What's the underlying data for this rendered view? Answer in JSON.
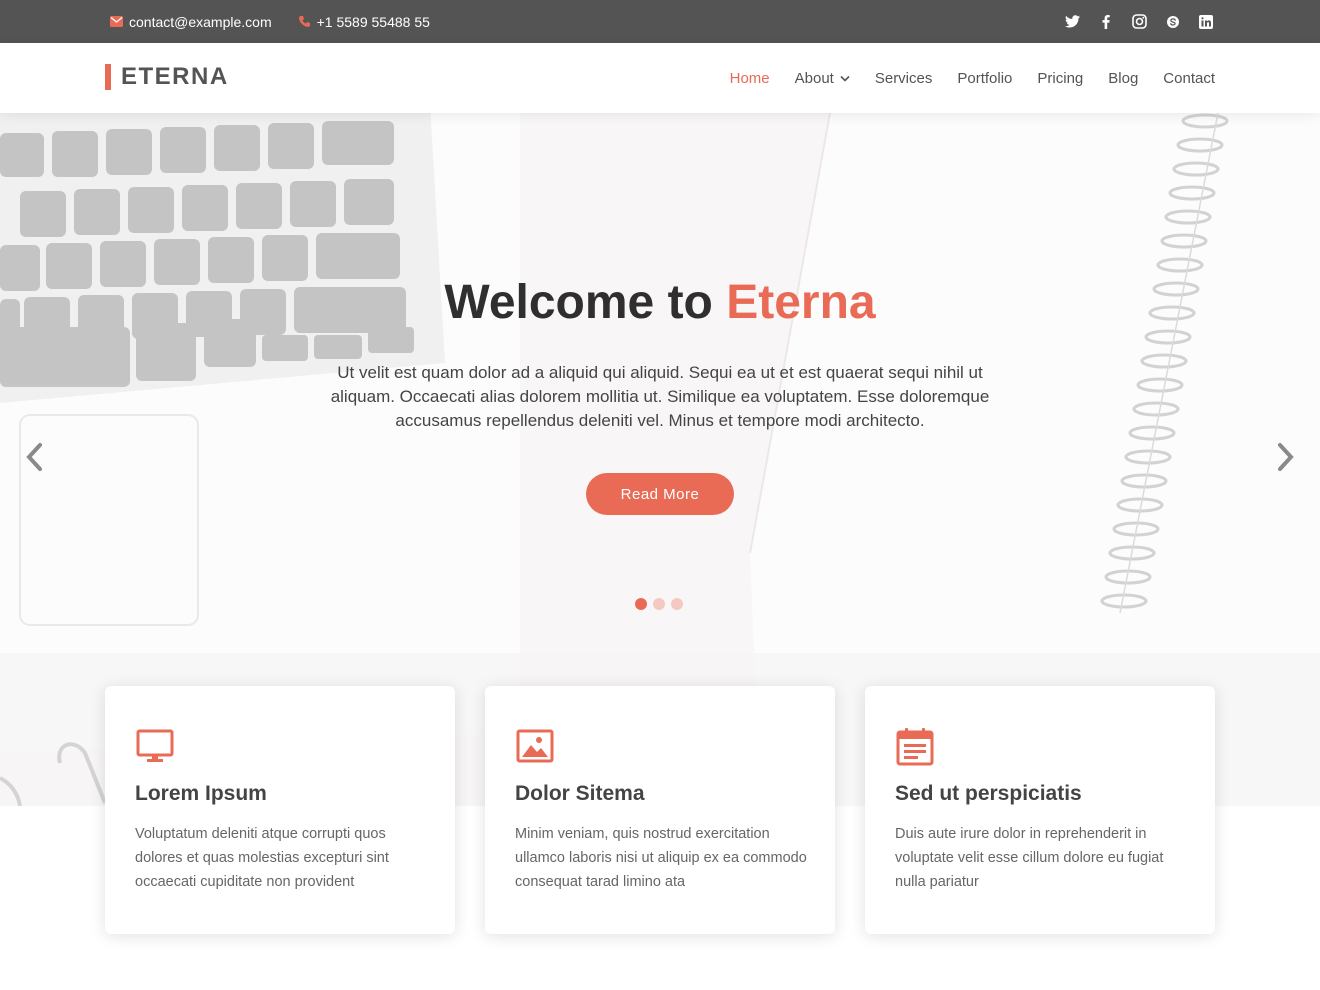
{
  "topbar": {
    "email": "contact@example.com",
    "phone": "+1 5589 55488 55",
    "social": [
      "twitter-icon",
      "facebook-icon",
      "instagram-icon",
      "skype-icon",
      "linkedin-icon"
    ]
  },
  "header": {
    "logo": "ETERNA",
    "nav": [
      {
        "label": "Home",
        "active": true
      },
      {
        "label": "About",
        "dropdown": true
      },
      {
        "label": "Services"
      },
      {
        "label": "Portfolio"
      },
      {
        "label": "Pricing"
      },
      {
        "label": "Blog"
      },
      {
        "label": "Contact"
      }
    ]
  },
  "hero": {
    "title_prefix": "Welcome to ",
    "title_accent": "Eterna",
    "text": "Ut velit est quam dolor ad a aliquid qui aliquid. Sequi ea ut et est quaerat sequi nihil ut aliquam. Occaecati alias dolorem mollitia ut. Similique ea voluptatem. Esse doloremque accusamus repellendus deleniti vel. Minus et tempore modi architecto.",
    "button": "Read More",
    "slides_total": 3,
    "active_slide": 1
  },
  "cards": [
    {
      "icon": "monitor-icon",
      "title": "Lorem Ipsum",
      "text": "Voluptatum deleniti atque corrupti quos dolores et quas molestias excepturi sint occaecati cupiditate non provident"
    },
    {
      "icon": "image-icon",
      "title": "Dolor Sitema",
      "text": "Minim veniam, quis nostrud exercitation ullamco laboris nisi ut aliquip ex ea commodo consequat tarad limino ata"
    },
    {
      "icon": "calendar-icon",
      "title": "Sed ut perspiciatis",
      "text": "Duis aute irure dolor in reprehenderit in voluptate velit esse cillum dolore eu fugiat nulla pariatur"
    }
  ],
  "colors": {
    "accent": "#e96b56",
    "topbar": "#545454",
    "text": "#444444"
  }
}
